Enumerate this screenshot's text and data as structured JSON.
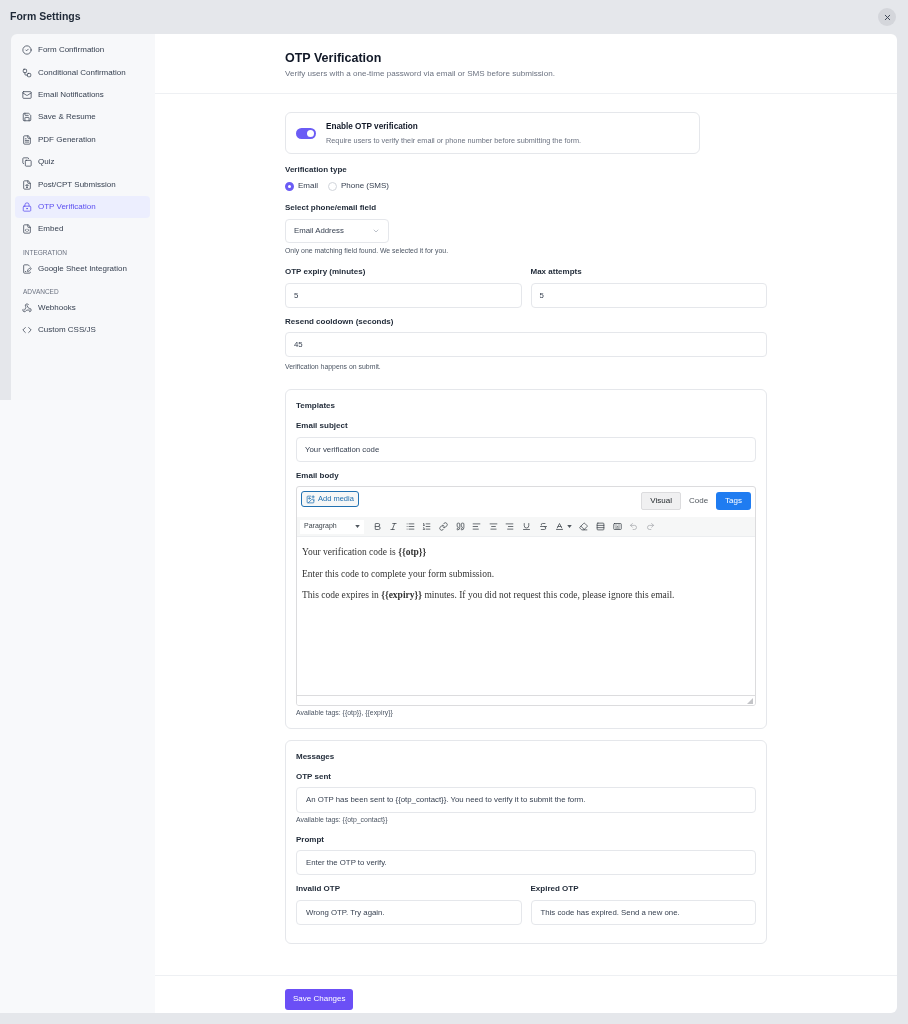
{
  "window": {
    "title": "Form Settings"
  },
  "sidebar": {
    "groups": [
      {
        "items": [
          {
            "label": "Form Confirmation",
            "selected": false
          },
          {
            "label": "Conditional Confirmation",
            "selected": false
          },
          {
            "label": "Email Notifications",
            "selected": false
          },
          {
            "label": "Save & Resume",
            "selected": false
          },
          {
            "label": "PDF Generation",
            "selected": false
          },
          {
            "label": "Quiz",
            "selected": false
          },
          {
            "label": "Post/CPT Submission",
            "selected": false
          },
          {
            "label": "OTP Verification",
            "selected": true
          },
          {
            "label": "Embed",
            "selected": false
          }
        ]
      },
      {
        "heading": "INTEGRATION",
        "items": [
          {
            "label": "Google Sheet Integration",
            "selected": false
          }
        ]
      },
      {
        "heading": "ADVANCED",
        "items": [
          {
            "label": "Webhooks",
            "selected": false
          },
          {
            "label": "Custom CSS/JS",
            "selected": false
          }
        ]
      }
    ]
  },
  "page": {
    "title": "OTP Verification",
    "subtitle": "Verify users with a one-time password via email or SMS before submission."
  },
  "enable_toggle": {
    "title": "Enable OTP verification",
    "description": "Require users to verify their email or phone number before submitting the form.",
    "on": true
  },
  "verification_type": {
    "label": "Verification type",
    "options": [
      {
        "label": "Email",
        "selected": true
      },
      {
        "label": "Phone (SMS)",
        "selected": false
      }
    ]
  },
  "field_select": {
    "label": "Select phone/email field",
    "value": "Email Address",
    "hint": "Only one matching field found. We selected it for you."
  },
  "otp_expiry": {
    "label": "OTP expiry (minutes)",
    "value": "5"
  },
  "max_attempts": {
    "label": "Max attempts",
    "value": "5"
  },
  "resend_cooldown": {
    "label": "Resend cooldown (seconds)",
    "value": "45",
    "hint": "Verification happens on submit."
  },
  "templates": {
    "title": "Templates",
    "email_subject": {
      "label": "Email subject",
      "value": "Your verification code"
    },
    "email_body": {
      "label": "Email body",
      "add_media": "Add media",
      "mode_tabs": [
        {
          "label": "Visual",
          "selected": true
        },
        {
          "label": "Code",
          "selected": false
        }
      ],
      "tags_button": "Tags",
      "format_select": "Paragraph",
      "paragraphs": [
        "Your verification code is **{{otp}}**",
        "Enter this code to complete your form submission.",
        "This code expires in **{{expiry}}** minutes. If you did not request this code, please ignore this email."
      ],
      "hint": "Available tags: {{otp}}, {{expiry}}"
    }
  },
  "messages": {
    "title": "Messages",
    "otp_sent": {
      "label": "OTP sent",
      "value": "An OTP has been sent to {{otp_contact}}. You need to verify it to submit the form.",
      "hint": "Available tags: {{otp_contact}}"
    },
    "prompt": {
      "label": "Prompt",
      "value": "Enter the OTP to verify."
    },
    "invalid_otp": {
      "label": "Invalid OTP",
      "value": "Wrong OTP. Try again."
    },
    "expired_otp": {
      "label": "Expired OTP",
      "value": "This code has expired. Send a new one."
    }
  },
  "footer": {
    "save_button": "Save Changes"
  }
}
